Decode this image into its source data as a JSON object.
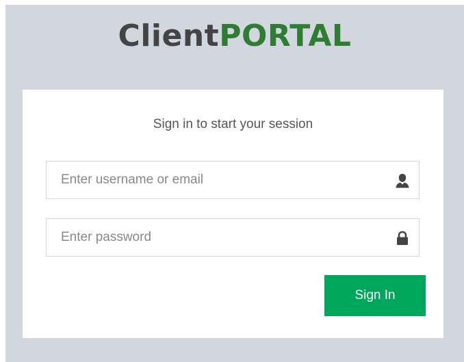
{
  "logo": {
    "part1": "Client",
    "part2": "PORTAL"
  },
  "login": {
    "message": "Sign in to start your session",
    "username": {
      "value": "",
      "placeholder": "Enter username or email",
      "icon": "user-icon"
    },
    "password": {
      "value": "",
      "placeholder": "Enter password",
      "icon": "lock-icon"
    },
    "submit_label": "Sign In"
  },
  "colors": {
    "page_background": "#d2d6de",
    "logo_dark": "#444444",
    "logo_accent": "#2e7d32",
    "button": "#00a65a"
  }
}
